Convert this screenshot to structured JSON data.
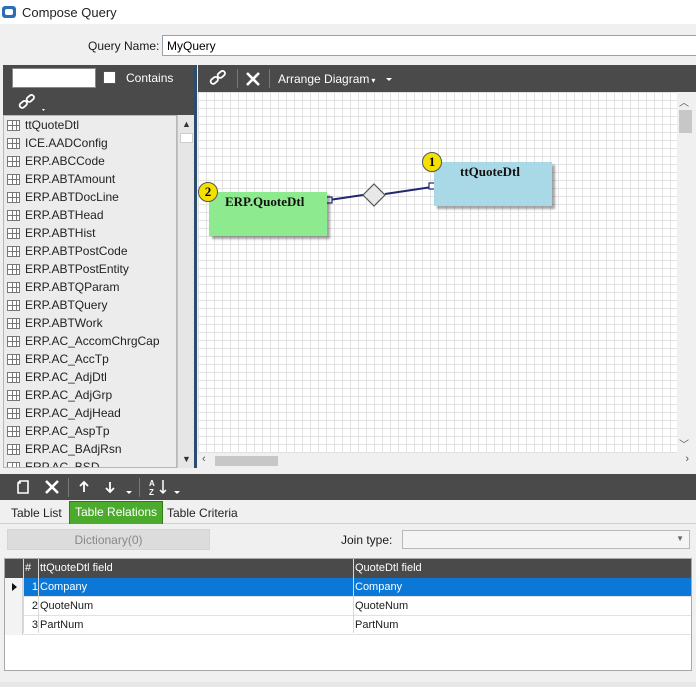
{
  "window": {
    "title": "Compose Query"
  },
  "query": {
    "name_label": "Query Name:",
    "name_value": "MyQuery"
  },
  "left_panel": {
    "search_value": "",
    "contains_label": "Contains",
    "tables": [
      "ttQuoteDtl",
      "ICE.AADConfig",
      "ERP.ABCCode",
      "ERP.ABTAmount",
      "ERP.ABTDocLine",
      "ERP.ABTHead",
      "ERP.ABTHist",
      "ERP.ABTPostCode",
      "ERP.ABTPostEntity",
      "ERP.ABTQParam",
      "ERP.ABTQuery",
      "ERP.ABTWork",
      "ERP.AC_AccomChrgCap",
      "ERP.AC_AccTp",
      "ERP.AC_AdjDtl",
      "ERP.AC_AdjGrp",
      "ERP.AC_AdjHead",
      "ERP.AC_AspTp",
      "ERP.AC_BAdjRsn",
      "ERP.AC_BSD"
    ]
  },
  "diagram_toolbar": {
    "arrange_label": "Arrange Diagram"
  },
  "diagram": {
    "tables": [
      {
        "badge": "2",
        "name": "ERP.QuoteDtl",
        "color": "#8eea8e"
      },
      {
        "badge": "1",
        "name": "ttQuoteDtl",
        "color": "#a9d8e6"
      }
    ],
    "link_color": "#1f2a6e"
  },
  "tabs": [
    "Table List",
    "Table Relations",
    "Table Criteria"
  ],
  "active_tab": "Table Relations",
  "relations": {
    "dictionary_label": "Dictionary(0)",
    "join_type_label": "Join type:",
    "join_type_value": "",
    "columns": {
      "num": "#",
      "left": "ttQuoteDtl field",
      "right": "QuoteDtl field"
    },
    "rows": [
      {
        "num": "1",
        "left": "Company",
        "right": "Company"
      },
      {
        "num": "2",
        "left": "QuoteNum",
        "right": "QuoteNum"
      },
      {
        "num": "3",
        "left": "PartNum",
        "right": "PartNum"
      }
    ]
  },
  "colors": {
    "toolbar": "#4a4a4a",
    "accent": "#4caa2d",
    "selection": "#0b78d7",
    "splitter": "#2c4c6e"
  }
}
